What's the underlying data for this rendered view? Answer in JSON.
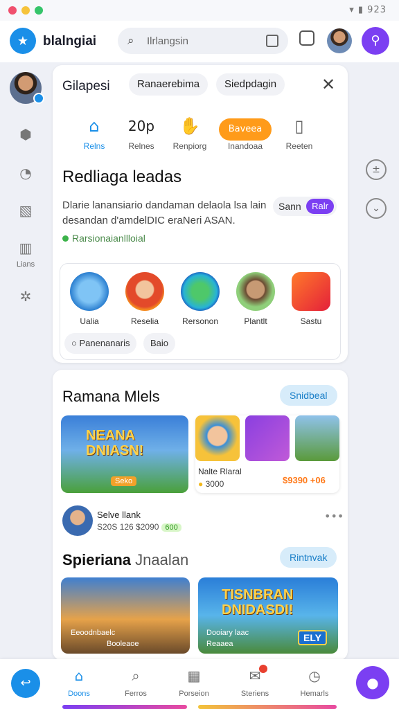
{
  "status_bar": {
    "icons_text": "▾ ▮ 923"
  },
  "top_bar": {
    "app_name": "blalngiai",
    "search_placeholder": "Ilrlangsin",
    "colors": {
      "brand": "#1a8fe8",
      "accent": "#7b3ff2"
    }
  },
  "side_rail": {
    "item_label": "Lians"
  },
  "panel": {
    "title": "Gilapesi",
    "chips": [
      "Ranaerebima",
      "Siedpdagin"
    ],
    "categories": [
      {
        "label": "Relns",
        "icon": "home-icon",
        "active": true
      },
      {
        "label": "Relnes",
        "value": "20p"
      },
      {
        "label": "Renpiorg",
        "icon": "hand-icon"
      },
      {
        "label": "Inandoaa",
        "pill": "Baveea"
      },
      {
        "label": "Reeten",
        "icon": "document-icon"
      }
    ],
    "heading": "Redliaga leadas",
    "description": "Dlarie lanansiario dandaman delaola lsa lain desandan d'amdelDIC eraNeri ASAN.",
    "sort_label": "Sann",
    "sort_pill": "Ralr",
    "status_text": "Rarsionaianllloial",
    "apps": [
      "Ualia",
      "Reselia",
      "Rersonon",
      "Plantlt",
      "Sastu"
    ],
    "mini_chips": [
      "Panenanaris",
      "Baio"
    ]
  },
  "feed": {
    "section1_title": "Ramana Mlels",
    "section1_button": "Snidbeal",
    "banner1_title": "NEANA DNIASN!",
    "banner1_sub": "Seko",
    "card_title": "Nalte Rlaral",
    "card_coins": "3000",
    "card_price": "$9390 +06",
    "user_name": "Selve llank",
    "user_meta": "S20S 126 $2090",
    "user_badge": "600",
    "section2_title": "Spieriana",
    "section2_title_light": "Jnaalan",
    "section2_button": "Rintnvak",
    "banner2_sub_a": "Eeoodnbaelc",
    "banner2_sub_b": "Booleaoe",
    "banner3_title": "TISNBRAN DNIDASDI!",
    "banner3_sub_a": "Dooiary laac",
    "banner3_sub_b": "Reaaea",
    "banner3_tag": "ELY"
  },
  "bottom_nav": [
    {
      "label": "Doons",
      "icon": "home-icon",
      "active": true
    },
    {
      "label": "Ferros",
      "icon": "search-icon"
    },
    {
      "label": "Porseion",
      "icon": "grid-icon"
    },
    {
      "label": "Steriens",
      "icon": "messages-icon",
      "badge": true
    },
    {
      "label": "Hemarls",
      "icon": "clock-icon"
    }
  ]
}
